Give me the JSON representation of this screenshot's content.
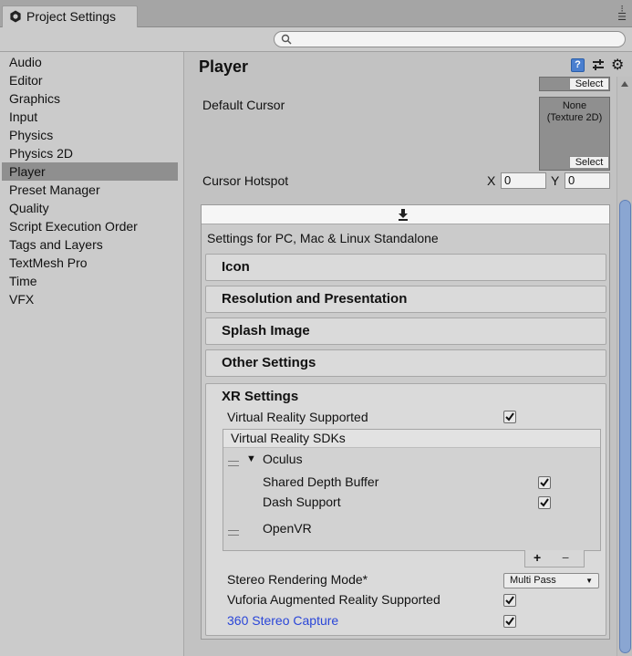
{
  "window": {
    "tab_title": "Project Settings",
    "menu_icon": "kebab-menu-icon"
  },
  "search": {
    "placeholder": ""
  },
  "sidebar": {
    "items": [
      {
        "label": "Audio"
      },
      {
        "label": "Editor"
      },
      {
        "label": "Graphics"
      },
      {
        "label": "Input"
      },
      {
        "label": "Physics"
      },
      {
        "label": "Physics 2D"
      },
      {
        "label": "Player",
        "active": true
      },
      {
        "label": "Preset Manager"
      },
      {
        "label": "Quality"
      },
      {
        "label": "Script Execution Order"
      },
      {
        "label": "Tags and Layers"
      },
      {
        "label": "TextMesh Pro"
      },
      {
        "label": "Time"
      },
      {
        "label": "VFX"
      }
    ]
  },
  "main": {
    "title": "Player",
    "help_icon_glyph": "?",
    "default_cursor": {
      "label": "Default Cursor",
      "select_top": "Select",
      "none_text_line1": "None",
      "none_text_line2": "(Texture 2D)",
      "select_bottom": "Select"
    },
    "cursor_hotspot": {
      "label": "Cursor Hotspot",
      "x_label": "X",
      "x_value": "0",
      "y_label": "Y",
      "y_value": "0"
    },
    "platform": {
      "settings_for": "Settings for PC, Mac & Linux Standalone",
      "sections": [
        "Icon",
        "Resolution and Presentation",
        "Splash Image",
        "Other Settings"
      ],
      "xr": {
        "title": "XR Settings",
        "vr_supported_label": "Virtual Reality Supported",
        "vr_supported": true,
        "sdks_header": "Virtual Reality SDKs",
        "sdk_oculus": "Oculus",
        "shared_depth_label": "Shared Depth Buffer",
        "shared_depth": true,
        "dash_support_label": "Dash Support",
        "dash_support": true,
        "sdk_openvr": "OpenVR",
        "add_glyph": "+",
        "remove_glyph": "−",
        "stereo_mode_label": "Stereo Rendering Mode*",
        "stereo_mode_value": "Multi Pass",
        "vuforia_label": "Vuforia Augmented Reality Supported",
        "vuforia": true,
        "stereo_capture_label": "360 Stereo Capture",
        "stereo_capture": true
      }
    }
  },
  "colors": {
    "link_blue": "#2a46d8",
    "active_item": "#8f8f8f",
    "scroll_thumb": "#8aa6d2"
  }
}
